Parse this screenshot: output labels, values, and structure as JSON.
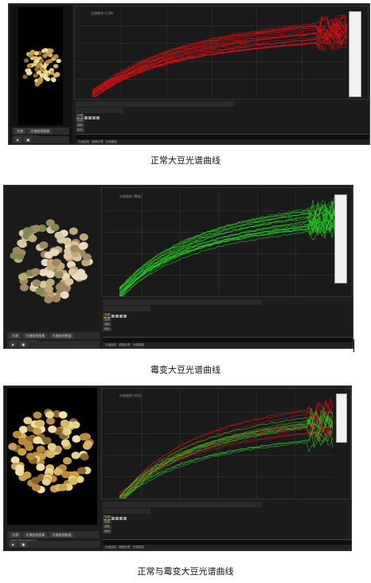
{
  "screens": [
    {
      "caption": "正常大豆光谱曲线",
      "chart_title": "光谱曲线 (正常)",
      "tabs": [
        "光谱",
        "光谱曲线图像",
        "光谱曲线数据"
      ],
      "status": [
        "光谱曲线",
        "图像处理",
        "光谱数据"
      ],
      "side_labels": [
        "光谱",
        "反射",
        "透射",
        "吸收"
      ],
      "legend_color": "#cc0000"
    },
    {
      "caption": "霉变大豆光谱曲线",
      "chart_title": "光谱曲线 (霉变)",
      "tabs": [
        "光谱",
        "光谱曲线图像",
        "光谱曲线数据",
        "高光谱数据保存"
      ],
      "status": [
        "光谱曲线",
        "图像处理",
        "光谱数据"
      ],
      "side_labels": [
        "光谱",
        "反射",
        "透射",
        "吸收"
      ],
      "legend_color": "#00aa00"
    },
    {
      "caption": "正常与霉变大豆光谱曲线",
      "chart_title": "光谱曲线 (对比)",
      "tabs": [
        "光谱",
        "光谱曲线图像",
        "光谱曲线数据",
        "高光谱数据保存"
      ],
      "status": [
        "光谱曲线",
        "图像处理",
        "光谱数据"
      ],
      "side_labels": [
        "光谱",
        "反射",
        "透射",
        "吸收"
      ],
      "legend_color": "#cc0000"
    }
  ],
  "colors": {
    "normal": "#e01010",
    "mold": "#22dd22",
    "grid": "#3a3a3a",
    "background": "#1a1a1a"
  }
}
